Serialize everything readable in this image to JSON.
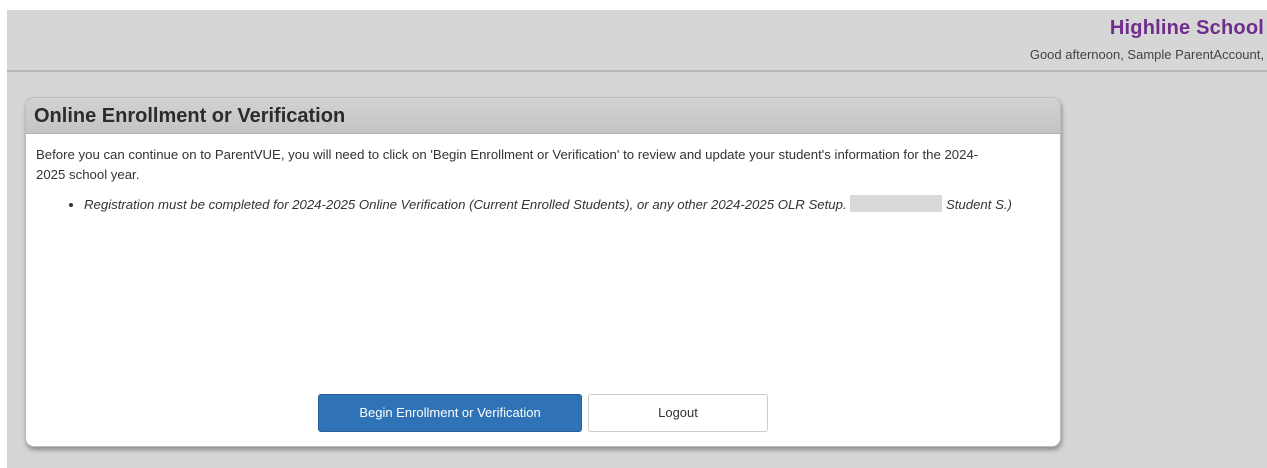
{
  "header": {
    "school_name": "Highline School",
    "greeting": "Good afternoon, Sample ParentAccount,"
  },
  "panel": {
    "title": "Online Enrollment or Verification",
    "intro_text": "Before you can continue on to ParentVUE, you will need to click on 'Begin Enrollment or Verification' to review and update your student's information for the 2024-2025 school year.",
    "notice": {
      "text_before": "Registration must be completed for 2024-2025 Online Verification (Current Enrolled Students), or any other 2024-2025 OLR Setup. ",
      "text_after": " Student S.)"
    },
    "buttons": {
      "begin_label": "Begin Enrollment or Verification",
      "logout_label": "Logout"
    }
  },
  "colors": {
    "school_name": "#6e2e8c",
    "primary_button": "#2f73b6",
    "page_background": "#d6d6d6"
  }
}
